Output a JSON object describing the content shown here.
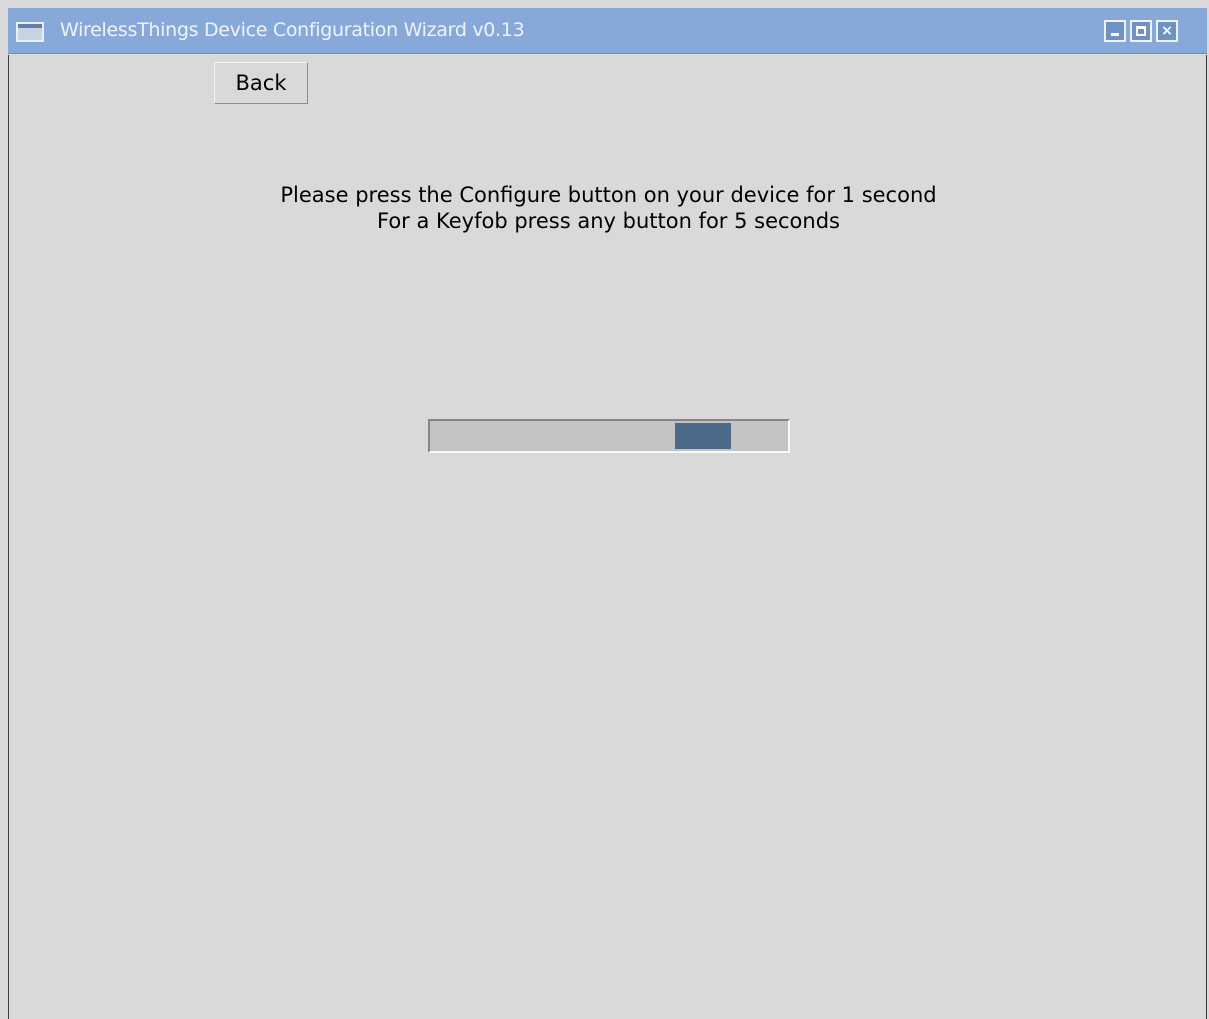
{
  "window": {
    "title": "WirelessThings Device Configuration Wizard v0.13",
    "icon": "window-app-icon",
    "controls": {
      "minimize_icon": "minimize-icon",
      "maximize_icon": "maximize-icon",
      "close_icon": "close-icon",
      "close_glyph": "×"
    }
  },
  "toolbar": {
    "back_label": "Back"
  },
  "instructions": {
    "line1": "Please press the Configure button on your device for 1 second",
    "line2": "For a Keyfob press any button for 5 seconds"
  },
  "progress": {
    "mode": "indeterminate",
    "block_position_fraction": 0.81,
    "block_color": "#4b6a8a",
    "track_color": "#c3c3c3"
  },
  "colors": {
    "titlebar": "#87a9d9",
    "background": "#d9d9d9"
  }
}
